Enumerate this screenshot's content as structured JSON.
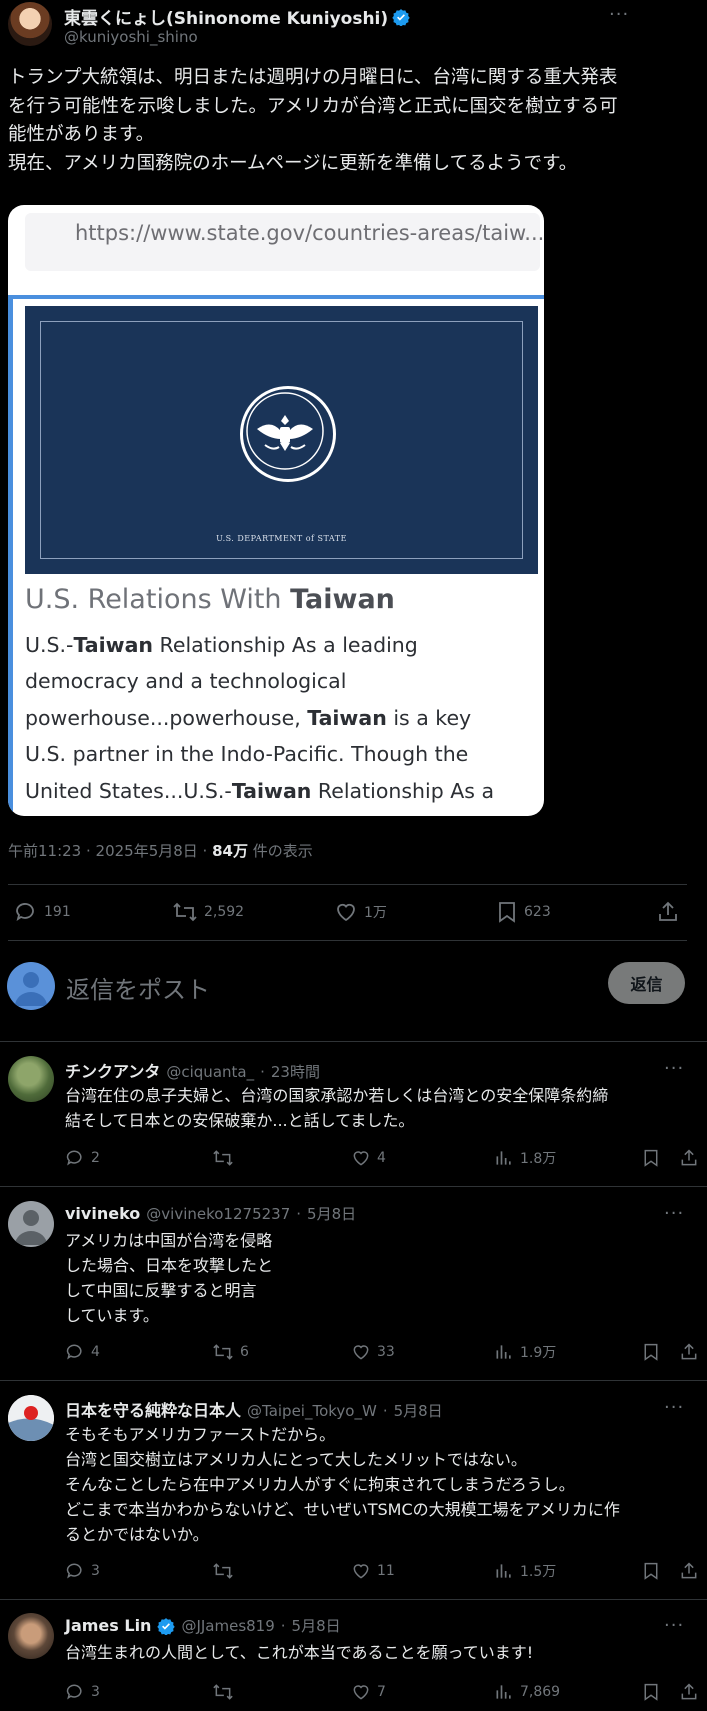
{
  "main_post": {
    "author_name": "東雲くにょし(Shinonome Kuniyoshi)",
    "author_handle": "@kuniyoshi_shino",
    "more_label": "···",
    "text_lines": [
      "トランプ大統領は、明日または週明けの月曜日に、台湾に関する重大発表",
      "を行う可能性を示唆しました。アメリカが台湾と正式に国交を樹立する可",
      "能性があります。",
      "現在、アメリカ国務院のホームページに更新を準備してるようです。"
    ],
    "image": {
      "url_text": "https://www.state.gov/countries-areas/taiw...",
      "banner_caption": "U.S. DEPARTMENT of STATE",
      "heading_prefix": "U.S. Relations With ",
      "heading_bold": "Taiwan",
      "snippet_lines": [
        [
          "U.S.-",
          "Taiwan",
          " Relationship As a leading"
        ],
        [
          "democracy and a technological",
          "",
          ""
        ],
        [
          "powerhouse...powerhouse, ",
          "Taiwan",
          " is a key"
        ],
        [
          "U.S. partner in the Indo-Pacific. Though the",
          "",
          ""
        ],
        [
          "United States...U.S.-",
          "Taiwan",
          " Relationship As a"
        ]
      ]
    },
    "timestamp": "午前11:23 · 2025年5月8日 · ",
    "views_count": "84万",
    "views_label": " 件の表示",
    "stats": {
      "replies": "191",
      "reposts": "2,592",
      "likes": "1万",
      "bookmarks": "623"
    }
  },
  "reply_compose": {
    "placeholder": "返信をポスト",
    "button_label": "返信"
  },
  "replies": [
    {
      "name": "チンクアンタ",
      "handle": "@ciquanta_",
      "time": "23時間",
      "text_lines": [
        "台湾在住の息子夫婦と、台湾の国家承認か若しくは台湾との安全保障条約締",
        "結そして日本との安保破棄か...と話してました。"
      ],
      "replies": "2",
      "reposts": "",
      "likes": "4",
      "views": "1.8万",
      "verified": false
    },
    {
      "name": "vivineko",
      "handle": "@vivineko1275237",
      "time": "5月8日",
      "text_lines": [
        "アメリカは中国が台湾を侵略",
        "した場合、日本を攻撃したと",
        "して中国に反撃すると明言",
        "しています。"
      ],
      "replies": "4",
      "reposts": "6",
      "likes": "33",
      "views": "1.9万",
      "verified": false
    },
    {
      "name": "日本を守る純粋な日本人",
      "handle": "@Taipei_Tokyo_W",
      "time": "5月8日",
      "text_lines": [
        "そもそもアメリカファーストだから。",
        "台湾と国交樹立はアメリカ人にとって大したメリットではない。",
        "そんなことしたら在中アメリカ人がすぐに拘束されてしまうだろうし。",
        "どこまで本当かわからないけど、せいぜいTSMCの大規模工場をアメリカに作",
        "るとかではないか。"
      ],
      "replies": "3",
      "reposts": "",
      "likes": "11",
      "views": "1.5万",
      "verified": false
    },
    {
      "name": "James Lin",
      "handle": "@JJames819",
      "time": "5月8日",
      "text_lines": [
        "台湾生まれの人間として、これが本当であることを願っています!"
      ],
      "replies": "3",
      "reposts": "",
      "likes": "7",
      "views": "7,869",
      "verified": true
    }
  ],
  "separator": " · ",
  "colors": {
    "background": "#000000",
    "text": "#e7e9ea",
    "muted": "#71767b",
    "verified": "#1d9bf0",
    "divider": "#2f3336",
    "banner_navy": "#1a3458"
  }
}
